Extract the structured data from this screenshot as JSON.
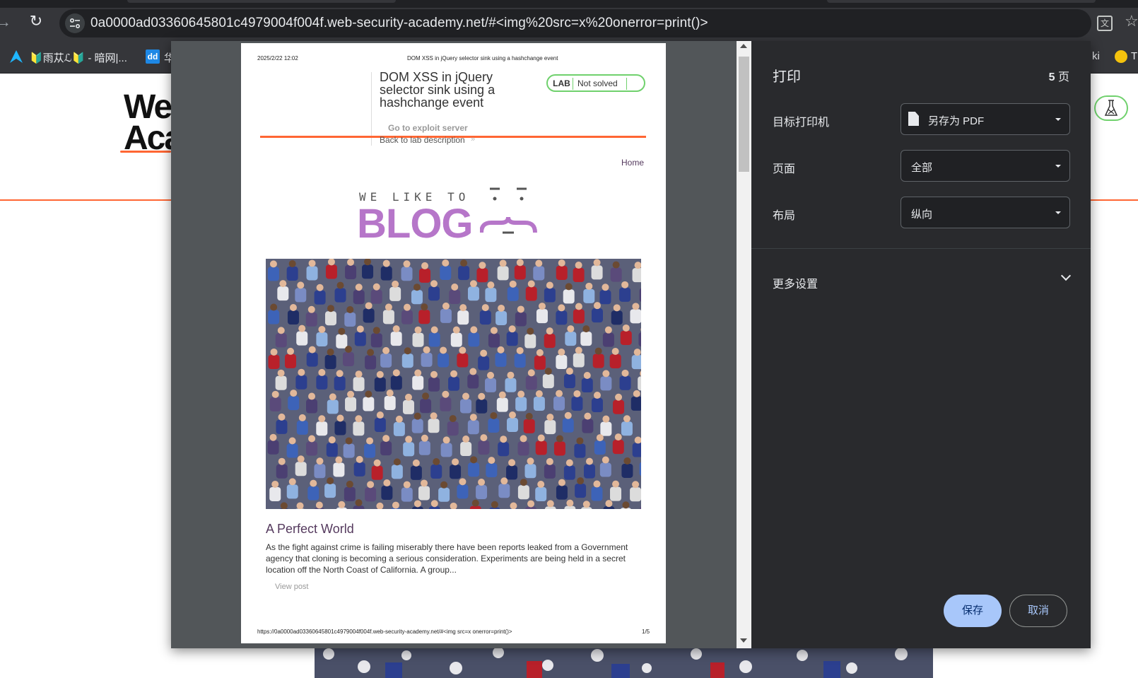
{
  "browser": {
    "url": "0a0000ad03360645801c4979004f004f.web-security-academy.net/#<img%20src=x%20onerror=print()>",
    "bookmarks": [
      {
        "label": "🔰雨苁ℒ🔰 - 暗网|...",
        "icon": "a-logo-icon"
      },
      {
        "label": "华",
        "icon": "dd-icon"
      },
      {
        "label": "ki",
        "icon": ""
      },
      {
        "label": "T",
        "icon": "yellow-circle-icon"
      }
    ]
  },
  "underlying_page": {
    "logo_line1": "Wel",
    "logo_line2": "Aca"
  },
  "print_dialog": {
    "title": "打印",
    "page_count": "5",
    "page_count_suffix": " 页",
    "destination_label": "目标打印机",
    "destination_value": "另存为 PDF",
    "pages_label": "页面",
    "pages_value": "全部",
    "layout_label": "布局",
    "layout_value": "纵向",
    "more_settings_label": "更多设置",
    "save_label": "保存",
    "cancel_label": "取消"
  },
  "pdf_preview": {
    "header_date": "2025/2/22 12:02",
    "header_title": "DOM XSS in jQuery selector sink using a hashchange event",
    "lab_title": "DOM XSS in jQuery selector sink using a hashchange event",
    "lab_badge": "LAB",
    "lab_status": "Not solved",
    "exploit_link": "Go to exploit server",
    "back_link": "Back to lab description",
    "back_arrow": "»",
    "home_link": "Home",
    "blog_tagline": "WE LIKE TO",
    "blog_word": "BLOG",
    "post_title": "A Perfect World",
    "post_excerpt": "As the fight against crime is failing miserably there have been reports leaked from a Government agency that cloning is becoming a serious consideration. Experiments are being held in a secret location off the North Coast of California. A group...",
    "view_post": "View post",
    "footer_url": "https://0a0000ad03360645801c4979004f004f.web-security-academy.net/#<img src=x onerror=print()>",
    "footer_page": "1/5"
  },
  "colors": {
    "accent_orange": "#ff6633",
    "blog_purple": "#b676c9",
    "link_purple": "#553a5e",
    "lab_green": "#70d16d",
    "save_blue": "#a8c7fa"
  }
}
